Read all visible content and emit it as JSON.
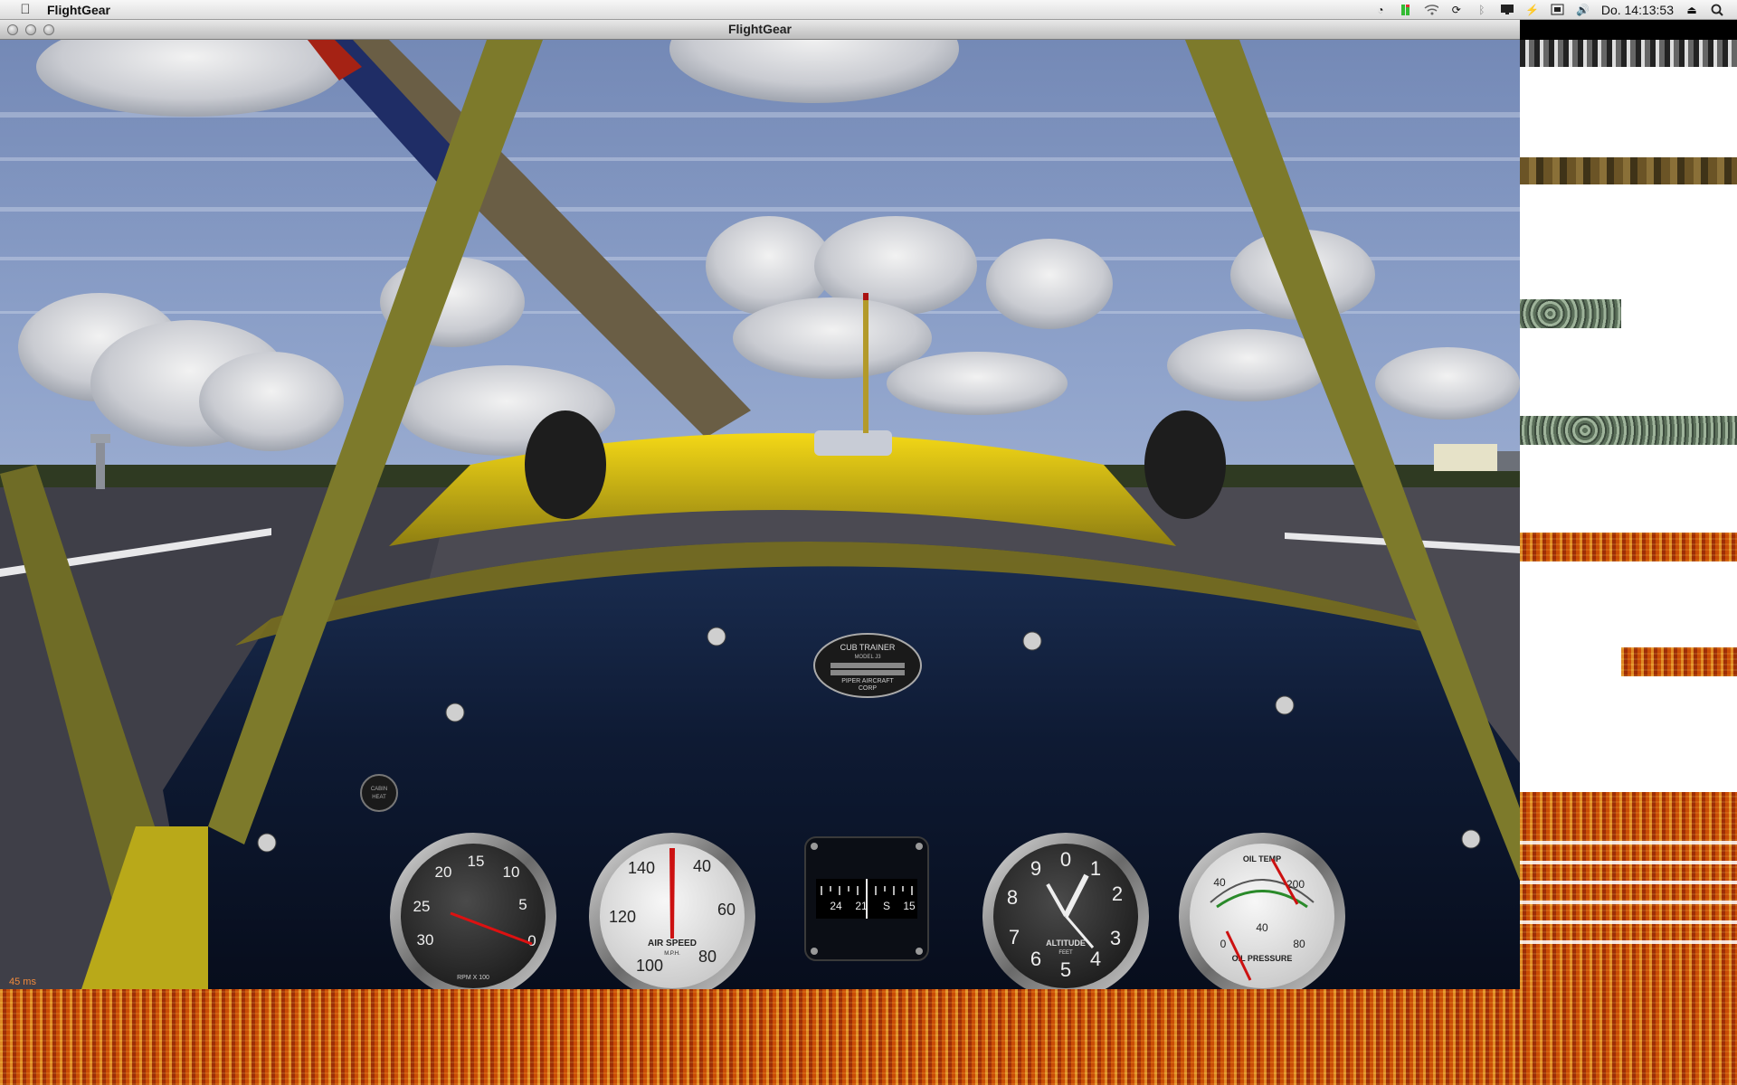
{
  "menubar": {
    "app_name": "FlightGear",
    "clock": "Do. 14:13:53",
    "icons": [
      "apple-icon",
      "time-machine-icon",
      "battery-meter-icon",
      "wifi-icon",
      "sync-icon",
      "bluetooth-icon",
      "display-icon",
      "bolt-icon",
      "keyboard-icon",
      "volume-icon",
      "eject-icon",
      "spotlight-icon"
    ]
  },
  "window": {
    "title": "FlightGear"
  },
  "view": {
    "frame_time": "45 ms"
  },
  "placard": {
    "title": "CUB TRAINER",
    "model": "MODEL J3",
    "maker": "PIPER AIRCRAFT",
    "corp": "CORP"
  },
  "instruments": {
    "tach": {
      "label": "RPM X 100",
      "ticks": [
        "20",
        "15",
        "10",
        "25",
        "5",
        "30",
        "0"
      ]
    },
    "airspeed": {
      "label": "AIR SPEED",
      "units": "M.P.H.",
      "ticks": [
        "140",
        "40",
        "120",
        "60",
        "100",
        "80"
      ]
    },
    "compass": {
      "ticks": [
        "24",
        "21",
        "S",
        "15"
      ]
    },
    "altimeter": {
      "label": "ALTITUDE",
      "units": "FEET",
      "ticks": [
        "0",
        "1",
        "2",
        "3",
        "4",
        "5",
        "6",
        "7",
        "8",
        "9"
      ]
    },
    "oil": {
      "temp_label": "OIL TEMP",
      "pressure_label": "OIL PRESSURE",
      "temp_ticks": [
        "40",
        "200"
      ],
      "pressure_ticks": [
        "0",
        "40",
        "80"
      ]
    },
    "cabin_heat": "CABIN HEAT"
  }
}
